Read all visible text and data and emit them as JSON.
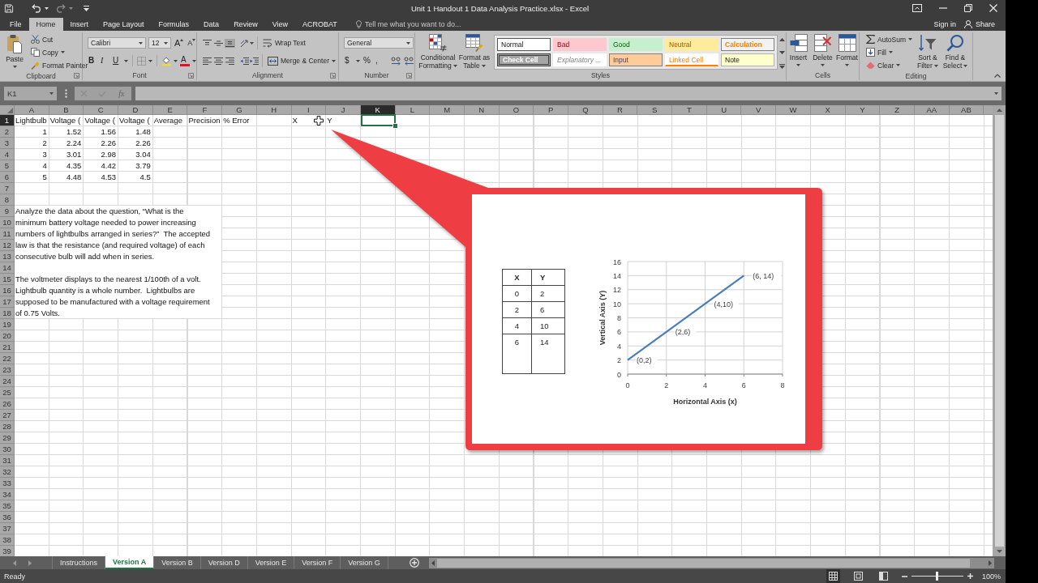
{
  "quick_access": [
    {
      "kind": "save",
      "disabled": false
    },
    {
      "kind": "undo",
      "disabled": false
    },
    {
      "kind": "redo",
      "disabled": true
    },
    {
      "kind": "customize",
      "disabled": false
    }
  ],
  "window": {
    "title": "Unit 1 Handout 1 Data Analysis Practice.xlsx - Excel"
  },
  "ribbon_tabs": [
    {
      "label": "File",
      "selected": false
    },
    {
      "label": "Home",
      "selected": true
    },
    {
      "label": "Insert",
      "selected": false
    },
    {
      "label": "Page Layout",
      "selected": false
    },
    {
      "label": "Formulas",
      "selected": false
    },
    {
      "label": "Data",
      "selected": false
    },
    {
      "label": "Review",
      "selected": false
    },
    {
      "label": "View",
      "selected": false
    },
    {
      "label": "ACROBAT",
      "selected": false
    }
  ],
  "tell_me": {
    "placeholder": "Tell me what you want to do..."
  },
  "account": {
    "sign_in": "Sign in",
    "share": "Share"
  },
  "ribbon": {
    "clipboard": {
      "label": "Clipboard",
      "paste": "Paste",
      "cut": "Cut",
      "copy": "Copy",
      "format_painter": "Format Painter"
    },
    "font": {
      "label": "Font",
      "font_name": "Calibri",
      "font_size": "12",
      "grow_font": "A",
      "shrink_font": "A",
      "bold": "B",
      "italic": "I",
      "underline": "U",
      "font_color": "A"
    },
    "alignment": {
      "label": "Alignment",
      "vertical": [
        {
          "selected": false
        },
        {
          "selected": false
        },
        {
          "selected": true
        }
      ],
      "horizontal": [
        {
          "selected": false
        },
        {
          "selected": false
        },
        {
          "selected": false
        }
      ],
      "wrap_text": "Wrap Text",
      "merge_center": "Merge & Center"
    },
    "number": {
      "label": "Number",
      "format": "General",
      "currency": "$",
      "percent": "%",
      "comma": ","
    },
    "styles": {
      "label": "Styles",
      "conditional_formatting": "Conditional Formatting",
      "format_as_table": "Format as Table",
      "gallery": [
        {
          "label": "Normal",
          "kind": "normal"
        },
        {
          "label": "Bad",
          "kind": "bad"
        },
        {
          "label": "Good",
          "kind": "good"
        },
        {
          "label": "Neutral",
          "kind": "neutral"
        },
        {
          "label": "Calculation",
          "kind": "calculation"
        },
        {
          "label": "Check Cell",
          "kind": "check"
        },
        {
          "label": "Explanatory ...",
          "kind": "explanatory"
        },
        {
          "label": "Input",
          "kind": "input"
        },
        {
          "label": "Linked Cell",
          "kind": "linked"
        },
        {
          "label": "Note",
          "kind": "note"
        }
      ]
    },
    "cells": {
      "label": "Cells",
      "insert": "Insert",
      "delete": "Delete",
      "format": "Format"
    },
    "editing": {
      "label": "Editing",
      "autosum": "AutoSum",
      "fill": "Fill",
      "clear": "Clear",
      "sort_filter": "Sort & Filter",
      "find_select": "Find & Select"
    }
  },
  "formula_bar": {
    "name_box": "K1",
    "cancel": {
      "disabled": true
    },
    "enter": {
      "disabled": true
    },
    "insert_function": "fx"
  },
  "sheet": {
    "columns": [
      {
        "label": "A",
        "selected": false
      },
      {
        "label": "B",
        "selected": false
      },
      {
        "label": "C",
        "selected": false
      },
      {
        "label": "D",
        "selected": false
      },
      {
        "label": "E",
        "selected": false
      },
      {
        "label": "F",
        "selected": false
      },
      {
        "label": "G",
        "selected": false
      },
      {
        "label": "H",
        "selected": false
      },
      {
        "label": "I",
        "selected": false
      },
      {
        "label": "J",
        "selected": false
      },
      {
        "label": "K",
        "selected": true
      },
      {
        "label": "L",
        "selected": false
      },
      {
        "label": "M",
        "selected": false
      },
      {
        "label": "N",
        "selected": false
      },
      {
        "label": "O",
        "selected": false
      },
      {
        "label": "P",
        "selected": false
      },
      {
        "label": "Q",
        "selected": false
      },
      {
        "label": "R",
        "selected": false
      },
      {
        "label": "S",
        "selected": false
      },
      {
        "label": "T",
        "selected": false
      },
      {
        "label": "U",
        "selected": false
      },
      {
        "label": "V",
        "selected": false
      },
      {
        "label": "W",
        "selected": false
      },
      {
        "label": "X",
        "selected": false
      },
      {
        "label": "Y",
        "selected": false
      },
      {
        "label": "Z",
        "selected": false
      },
      {
        "label": "AA",
        "selected": false
      },
      {
        "label": "AB",
        "selected": false
      }
    ],
    "rows": [
      {
        "label": "1",
        "selected": true,
        "cells": [
          {
            "text": "Lightbulb",
            "kind": "text"
          },
          {
            "text": "Voltage (",
            "kind": "text"
          },
          {
            "text": "Voltage (",
            "kind": "text"
          },
          {
            "text": "Voltage (",
            "kind": "text"
          },
          {
            "text": "Average",
            "kind": "text"
          },
          {
            "text": "Precision",
            "kind": "text"
          },
          {
            "text": "% Error",
            "kind": "text"
          },
          null,
          {
            "text": "X",
            "kind": "text"
          },
          {
            "text": "Y",
            "kind": "text"
          }
        ]
      },
      {
        "label": "2",
        "selected": false,
        "cells": [
          {
            "text": "1",
            "kind": "number"
          },
          {
            "text": "1.52",
            "kind": "number"
          },
          {
            "text": "1.56",
            "kind": "number"
          },
          {
            "text": "1.48",
            "kind": "number"
          }
        ]
      },
      {
        "label": "3",
        "selected": false,
        "cells": [
          {
            "text": "2",
            "kind": "number"
          },
          {
            "text": "2.24",
            "kind": "number"
          },
          {
            "text": "2.26",
            "kind": "number"
          },
          {
            "text": "2.26",
            "kind": "number"
          }
        ]
      },
      {
        "label": "4",
        "selected": false,
        "cells": [
          {
            "text": "3",
            "kind": "number"
          },
          {
            "text": "3.01",
            "kind": "number"
          },
          {
            "text": "2.98",
            "kind": "number"
          },
          {
            "text": "3.04",
            "kind": "number"
          }
        ]
      },
      {
        "label": "5",
        "selected": false,
        "cells": [
          {
            "text": "4",
            "kind": "number"
          },
          {
            "text": "4.35",
            "kind": "number"
          },
          {
            "text": "4.42",
            "kind": "number"
          },
          {
            "text": "3.79",
            "kind": "number"
          }
        ]
      },
      {
        "label": "6",
        "selected": false,
        "cells": [
          {
            "text": "5",
            "kind": "number"
          },
          {
            "text": "4.48",
            "kind": "number"
          },
          {
            "text": "4.53",
            "kind": "number"
          },
          {
            "text": "4.5",
            "kind": "number"
          }
        ]
      },
      {
        "label": "7",
        "selected": false
      },
      {
        "label": "8",
        "selected": false
      },
      {
        "label": "9",
        "selected": false
      },
      {
        "label": "10",
        "selected": false
      },
      {
        "label": "11",
        "selected": false
      },
      {
        "label": "12",
        "selected": false
      },
      {
        "label": "13",
        "selected": false
      },
      {
        "label": "14",
        "selected": false
      },
      {
        "label": "15",
        "selected": false
      },
      {
        "label": "16",
        "selected": false
      },
      {
        "label": "17",
        "selected": false
      },
      {
        "label": "18",
        "selected": false
      },
      {
        "label": "19",
        "selected": false
      },
      {
        "label": "20",
        "selected": false
      },
      {
        "label": "21",
        "selected": false
      },
      {
        "label": "22",
        "selected": false
      },
      {
        "label": "23",
        "selected": false
      },
      {
        "label": "24",
        "selected": false
      },
      {
        "label": "25",
        "selected": false
      },
      {
        "label": "26",
        "selected": false
      },
      {
        "label": "27",
        "selected": false
      },
      {
        "label": "28",
        "selected": false
      },
      {
        "label": "29",
        "selected": false
      },
      {
        "label": "30",
        "selected": false
      },
      {
        "label": "31",
        "selected": false
      },
      {
        "label": "32",
        "selected": false
      },
      {
        "label": "33",
        "selected": false
      },
      {
        "label": "34",
        "selected": false
      },
      {
        "label": "35",
        "selected": false
      },
      {
        "label": "36",
        "selected": false
      },
      {
        "label": "37",
        "selected": false
      },
      {
        "label": "38",
        "selected": false
      },
      {
        "label": "39",
        "selected": false
      }
    ],
    "notes": [
      {
        "lines": [
          "Analyze the data about the question, “What is the",
          "minimum battery voltage needed to power increasing",
          "numbers of lightbulbs arranged in series?”  The accepted",
          "law is that the resistance (and required voltage) of each",
          "consecutive bulb will add when in series."
        ]
      },
      {
        "lines": [
          "The voltmeter displays to the nearest 1/100th of a volt.",
          "Lightbulb quantity is a whole number.  Lightbulbs are",
          "supposed to be manufactured with a voltage requirement",
          "of 0.75 Volts."
        ]
      }
    ]
  },
  "callout": {
    "xy_table": {
      "columns": [
        "X",
        "Y"
      ],
      "rows": [
        [
          "0",
          "2"
        ],
        [
          "2",
          "6"
        ],
        [
          "4",
          "10"
        ],
        [
          "6",
          "14"
        ]
      ]
    },
    "chart_data": [
      {
        "type": "line",
        "xlabel": "Horizontal Axis (x)",
        "ylabel": "Vertical Axis (Y)",
        "x": [
          0,
          2,
          4,
          6
        ],
        "values": [
          2,
          6,
          10,
          14
        ],
        "color": "#4a7ebb",
        "xlim": [
          0,
          8
        ],
        "ylim": [
          0,
          16
        ],
        "xticks": [
          0,
          2,
          4,
          6,
          8
        ],
        "yticks": [
          0,
          2,
          4,
          6,
          8,
          10,
          12,
          14,
          16
        ],
        "grid": true,
        "annotations": [
          "(0,2)",
          "(2,6)",
          "(4,10)",
          "(6, 14)"
        ]
      }
    ]
  },
  "sheet_tabs": [
    {
      "label": "Instructions",
      "selected": false
    },
    {
      "label": "Version A",
      "selected": true
    },
    {
      "label": "Version B",
      "selected": false
    },
    {
      "label": "Version D",
      "selected": false
    },
    {
      "label": "Version E",
      "selected": false
    },
    {
      "label": "Version F",
      "selected": false
    },
    {
      "label": "Version G",
      "selected": false
    }
  ],
  "status_bar": {
    "status": "Ready",
    "views": [
      {
        "selected": true
      },
      {
        "selected": false
      },
      {
        "selected": false
      }
    ],
    "zoom": {
      "level": 0.5,
      "reading": "100%"
    }
  }
}
